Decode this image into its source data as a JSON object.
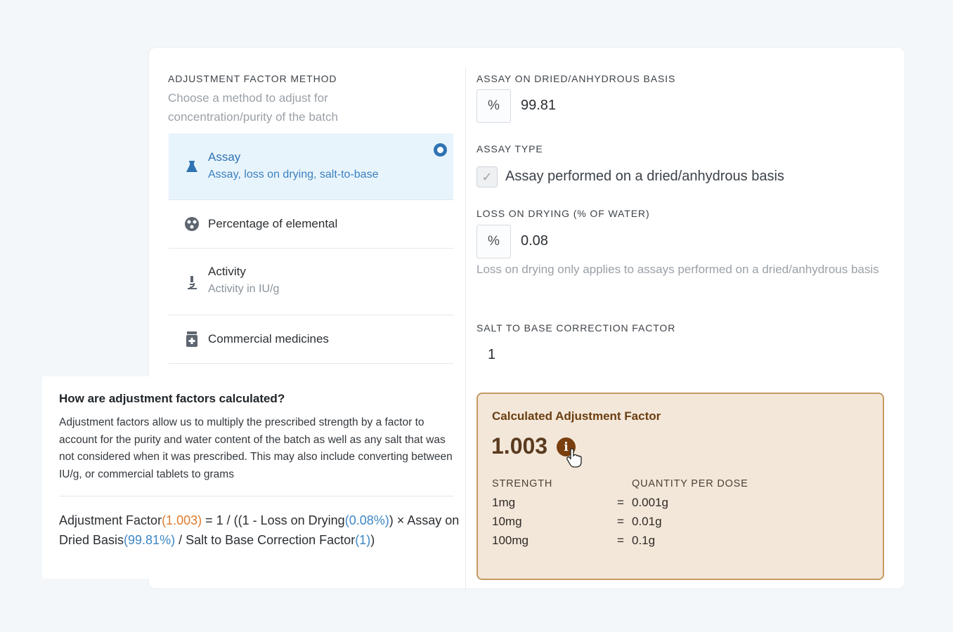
{
  "left_panel": {
    "section_label": "ADJUSTMENT FACTOR METHOD",
    "hint": "Choose a method to adjust for concentration/purity of the batch",
    "methods": [
      {
        "title": "Assay",
        "subtitle": "Assay, loss on drying, salt-to-base",
        "icon": "flask-icon",
        "selected": true
      },
      {
        "title": "Percentage of elemental",
        "subtitle": "",
        "icon": "molecule-icon",
        "selected": false
      },
      {
        "title": "Activity",
        "subtitle": "Activity in IU/g",
        "icon": "microscope-icon",
        "selected": false
      },
      {
        "title": "Commercial medicines",
        "subtitle": "",
        "icon": "pill-bottle-icon",
        "selected": false
      }
    ]
  },
  "right_panel": {
    "assay": {
      "label": "ASSAY ON DRIED/ANHYDROUS BASIS",
      "unit": "%",
      "value": "99.81"
    },
    "assay_type": {
      "label": "ASSAY TYPE",
      "checkbox_label": "Assay performed on a dried/anhydrous basis",
      "checked": true
    },
    "loss_on_drying": {
      "label": "LOSS ON DRYING (% OF WATER)",
      "unit": "%",
      "value": "0.08",
      "hint": "Loss on drying only applies to assays performed on a dried/anhydrous basis"
    },
    "salt_to_base": {
      "label": "SALT TO BASE CORRECTION FACTOR",
      "value": "1"
    }
  },
  "info": {
    "title": "How are adjustment factors calculated?",
    "body": "Adjustment factors allow us to multiply the prescribed strength by a factor to account for the purity and water content of the batch as well as any salt that was not considered when it was prescribed. This may also include converting between IU/g, or commercial tablets to grams",
    "formula": {
      "p1": "Adjustment Factor",
      "v1": "(1.003)",
      "p2": " = 1 / ((1 - Loss on Drying",
      "v2": "(0.08%)",
      "p3": ") × Assay on Dried Basis",
      "v3": "(99.81%)",
      "p4": " / Salt to Base Correction Factor",
      "v4": "(1)",
      "p5": ")"
    }
  },
  "result": {
    "title": "Calculated Adjustment Factor",
    "value": "1.003",
    "info_icon": "info-icon",
    "col_strength": "STRENGTH",
    "col_quantity": "QUANTITY PER DOSE",
    "rows": [
      {
        "strength": "1mg",
        "eq": "=",
        "quantity": "0.001g"
      },
      {
        "strength": "10mg",
        "eq": "=",
        "quantity": "0.01g"
      },
      {
        "strength": "100mg",
        "eq": "=",
        "quantity": "0.1g"
      }
    ]
  },
  "colors": {
    "accent_blue": "#2f73b3",
    "result_bg": "#f3e7d9",
    "result_border": "#c49b62",
    "formula_orange": "#e07b2c",
    "formula_blue": "#3c86c6"
  }
}
